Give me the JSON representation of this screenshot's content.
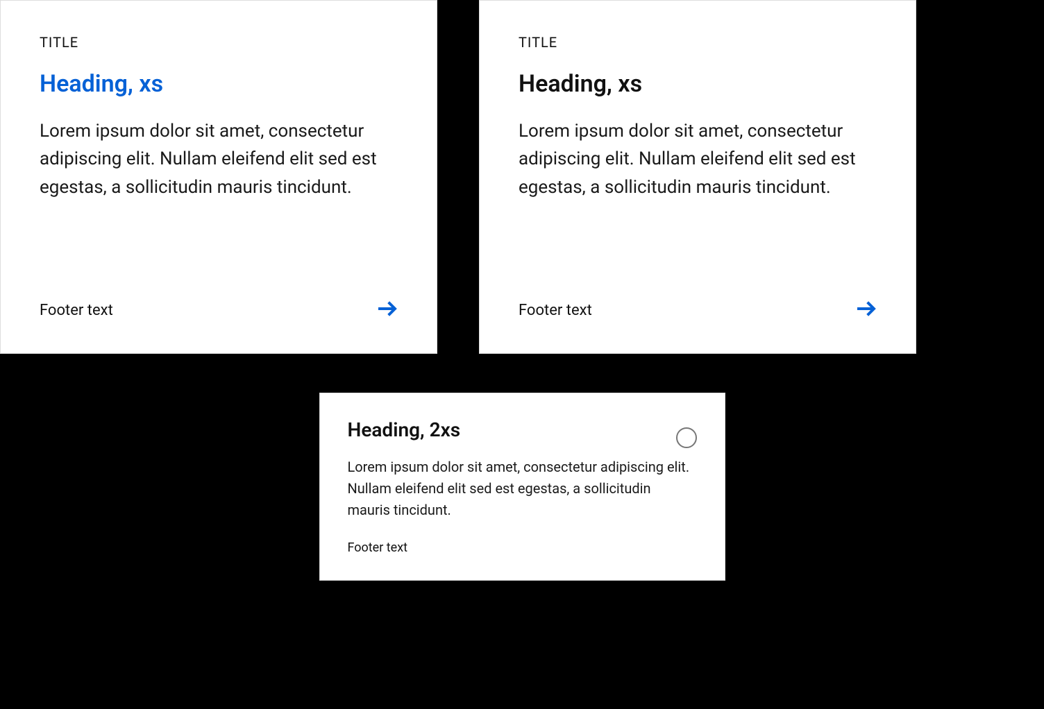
{
  "colors": {
    "accent": "#0561d6"
  },
  "cards": [
    {
      "title": "TITLE",
      "heading": "Heading, xs",
      "body": "Lorem ipsum dolor sit amet, consectetur adipiscing elit. Nullam eleifend elit sed est egestas, a sollicitudin mauris tincidunt.",
      "footer": "Footer text"
    },
    {
      "title": "TITLE",
      "heading": "Heading, xs",
      "body": "Lorem ipsum dolor sit amet, consectetur adipiscing elit. Nullam eleifend elit sed est egestas, a sollicitudin mauris tincidunt.",
      "footer": "Footer text"
    },
    {
      "heading": "Heading, 2xs",
      "body": "Lorem ipsum dolor sit amet, consectetur adipiscing elit. Nullam eleifend elit sed est egestas, a sollicitudin mauris tincidunt.",
      "footer": "Footer text"
    }
  ]
}
